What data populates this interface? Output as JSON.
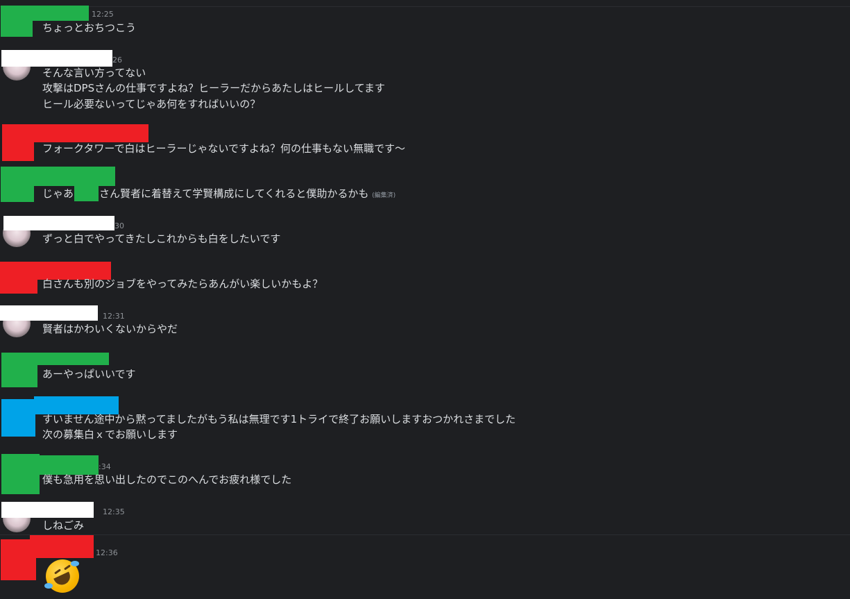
{
  "colors": {
    "background": "#1e1f22",
    "text": "#dbdee1",
    "timestamp": "#8e9297",
    "redaction_green": "#21b04b",
    "redaction_red": "#ee1f25",
    "redaction_white": "#ffffff",
    "redaction_blue": "#00a3e8"
  },
  "messages": [
    {
      "time": "12:25",
      "lines": [
        "ちょっとおちつこう"
      ]
    },
    {
      "time": "26",
      "lines": [
        "そんな言い方ってない",
        "攻撃はDPSさんの仕事ですよね？ヒーラーだからあたしはヒールしてます",
        "ヒール必要ないってじゃあ何をすればいいの？"
      ]
    },
    {
      "lines": [
        "フォークタワーで白はヒーラーじゃないですよね？何の仕事もない無職です～"
      ]
    },
    {
      "line_a": "じゃあ",
      "line_b": "さん賢者に着替えて学賢構成にしてくれると僕助かるかも",
      "edited": "(編集済)"
    },
    {
      "time": "30",
      "lines": [
        "ずっと白でやってきたしこれからも白をしたいです"
      ]
    },
    {
      "lines": [
        "白さんも別のジョブをやってみたらあんがい楽しいかもよ？"
      ]
    },
    {
      "time": "12:31",
      "lines": [
        "賢者はかわいくないからやだ"
      ]
    },
    {
      "lines": [
        "あーやっぱいいです"
      ]
    },
    {
      "lines": [
        "すいません途中から黙ってましたがもう私は無理です1トライで終了お願いしますおつかれさまでした",
        "次の募集白ｘでお願いします"
      ]
    },
    {
      "time": ":34",
      "lines": [
        "僕も急用を思い出したのでこのへんでお疲れ様でした"
      ]
    },
    {
      "time": "12:35",
      "lines": [
        "しねごみ"
      ]
    },
    {
      "time": "12:36",
      "emoji": "rolling-on-floor-laughing"
    }
  ]
}
